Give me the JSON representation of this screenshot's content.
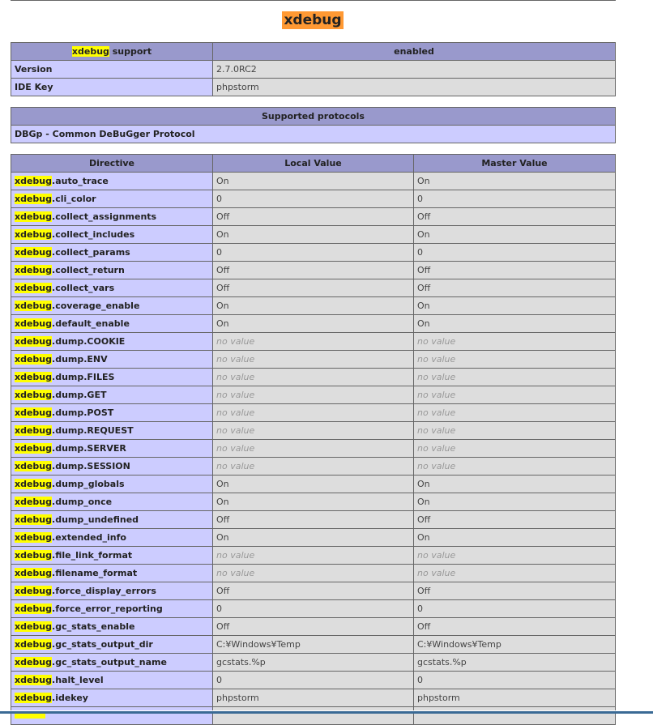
{
  "module_title": "xdebug",
  "support_table": {
    "header_hl": "xdebug",
    "header_rest": " support",
    "header_value": "enabled",
    "rows": [
      {
        "label": "Version",
        "value": "2.7.0RC2"
      },
      {
        "label": "IDE Key",
        "value": "phpstorm"
      }
    ]
  },
  "protocols_table": {
    "header": "Supported protocols",
    "row": "DBGp - Common DeBuGger Protocol"
  },
  "directives_table": {
    "headers": [
      "Directive",
      "Local Value",
      "Master Value"
    ],
    "prefix": "xdebug",
    "rows": [
      {
        "name": ".auto_trace",
        "local": "On",
        "master": "On"
      },
      {
        "name": ".cli_color",
        "local": "0",
        "master": "0"
      },
      {
        "name": ".collect_assignments",
        "local": "Off",
        "master": "Off"
      },
      {
        "name": ".collect_includes",
        "local": "On",
        "master": "On"
      },
      {
        "name": ".collect_params",
        "local": "0",
        "master": "0"
      },
      {
        "name": ".collect_return",
        "local": "Off",
        "master": "Off"
      },
      {
        "name": ".collect_vars",
        "local": "Off",
        "master": "Off"
      },
      {
        "name": ".coverage_enable",
        "local": "On",
        "master": "On"
      },
      {
        "name": ".default_enable",
        "local": "On",
        "master": "On"
      },
      {
        "name": ".dump.COOKIE",
        "local": "no value",
        "master": "no value"
      },
      {
        "name": ".dump.ENV",
        "local": "no value",
        "master": "no value"
      },
      {
        "name": ".dump.FILES",
        "local": "no value",
        "master": "no value"
      },
      {
        "name": ".dump.GET",
        "local": "no value",
        "master": "no value"
      },
      {
        "name": ".dump.POST",
        "local": "no value",
        "master": "no value"
      },
      {
        "name": ".dump.REQUEST",
        "local": "no value",
        "master": "no value"
      },
      {
        "name": ".dump.SERVER",
        "local": "no value",
        "master": "no value"
      },
      {
        "name": ".dump.SESSION",
        "local": "no value",
        "master": "no value"
      },
      {
        "name": ".dump_globals",
        "local": "On",
        "master": "On"
      },
      {
        "name": ".dump_once",
        "local": "On",
        "master": "On"
      },
      {
        "name": ".dump_undefined",
        "local": "Off",
        "master": "Off"
      },
      {
        "name": ".extended_info",
        "local": "On",
        "master": "On"
      },
      {
        "name": ".file_link_format",
        "local": "no value",
        "master": "no value"
      },
      {
        "name": ".filename_format",
        "local": "no value",
        "master": "no value"
      },
      {
        "name": ".force_display_errors",
        "local": "Off",
        "master": "Off"
      },
      {
        "name": ".force_error_reporting",
        "local": "0",
        "master": "0"
      },
      {
        "name": ".gc_stats_enable",
        "local": "Off",
        "master": "Off"
      },
      {
        "name": ".gc_stats_output_dir",
        "local": "C:¥Windows¥Temp",
        "master": "C:¥Windows¥Temp"
      },
      {
        "name": ".gc_stats_output_name",
        "local": "gcstats.%p",
        "master": "gcstats.%p"
      },
      {
        "name": ".halt_level",
        "local": "0",
        "master": "0"
      },
      {
        "name": ".idekey",
        "local": "phpstorm",
        "master": "phpstorm"
      },
      {
        "name": "",
        "local": "",
        "master": ""
      }
    ]
  }
}
